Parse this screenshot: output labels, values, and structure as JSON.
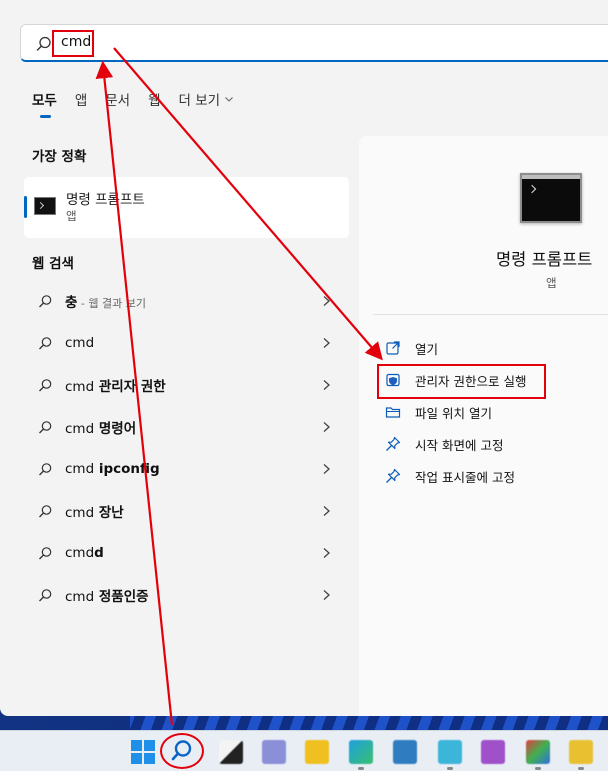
{
  "search": {
    "query": "cmd"
  },
  "tabs": [
    {
      "label": "모두",
      "active": true
    },
    {
      "label": "앱"
    },
    {
      "label": "문서"
    },
    {
      "label": "웹"
    },
    {
      "label": "더 보기"
    }
  ],
  "best_match": {
    "heading": "가장 정확",
    "item": {
      "name": "명령 프롬프트",
      "type": "앱",
      "icon": "command-prompt-icon"
    }
  },
  "web_search": {
    "heading": "웹 검색",
    "items": [
      {
        "query": "충",
        "hint": " - 웹 결과 보기"
      },
      {
        "query": "cmd",
        "bold": ""
      },
      {
        "query": "cmd",
        "bold": " 관리자 권한"
      },
      {
        "query": "cmd",
        "bold": " 명령어"
      },
      {
        "query": "cmd",
        "bold": " ipconfig"
      },
      {
        "query": "cmd",
        "bold": " 장난"
      },
      {
        "query": "cmd",
        "bold": "d"
      },
      {
        "query": "cmd",
        "bold": " 정품인증"
      }
    ]
  },
  "detail": {
    "title": "명령 프롬프트",
    "type": "앱",
    "actions": [
      {
        "label": "열기",
        "icon": "open-external-icon"
      },
      {
        "label": "관리자 권한으로 실행",
        "icon": "shield-icon"
      },
      {
        "label": "파일 위치 열기",
        "icon": "folder-icon"
      },
      {
        "label": "시작 화면에 고정",
        "icon": "pin-icon"
      },
      {
        "label": "작업 표시줄에 고정",
        "icon": "pin-icon"
      }
    ]
  },
  "colors": {
    "accent": "#0067c0",
    "annotation": "#e3000b",
    "panel": "#f3f3f3"
  }
}
